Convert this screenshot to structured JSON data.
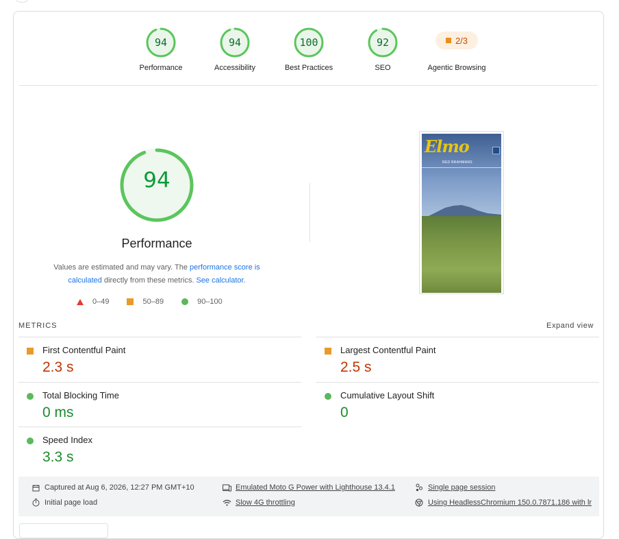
{
  "colors": {
    "pass": "#0c9a3a",
    "average": "#ea9a2a",
    "fail": "#e53935",
    "link": "#1a73e8"
  },
  "gauges": [
    {
      "score": "94",
      "label": "Performance",
      "fraction": 0.94
    },
    {
      "score": "94",
      "label": "Accessibility",
      "fraction": 0.94
    },
    {
      "score": "100",
      "label": "Best Practices",
      "fraction": 1.0
    },
    {
      "score": "92",
      "label": "SEO",
      "fraction": 0.92
    }
  ],
  "agentic": {
    "badge": "2/3",
    "label": "Agentic Browsing"
  },
  "main": {
    "score": "94",
    "fraction": 0.94,
    "title": "Performance",
    "desc_1": "Values are estimated and may vary. The ",
    "desc_link_1": "performance score is calculated",
    "desc_2": " directly from these metrics. ",
    "desc_link_2": "See calculator",
    "desc_3": ".",
    "legend": {
      "fail": "0–49",
      "average": "50–89",
      "pass": "90–100"
    }
  },
  "thumbnail": {
    "logo": "Elmo",
    "tagline": "RED BRAHMANS"
  },
  "metrics": {
    "heading": "METRICS",
    "expand": "Expand view",
    "fcp": {
      "name": "First Contentful Paint",
      "value": "2.3 s"
    },
    "lcp": {
      "name": "Largest Contentful Paint",
      "value": "2.5 s"
    },
    "tbt": {
      "name": "Total Blocking Time",
      "value": "0 ms"
    },
    "cls": {
      "name": "Cumulative Layout Shift",
      "value": "0"
    },
    "si": {
      "name": "Speed Index",
      "value": "3.3 s"
    }
  },
  "footer": {
    "captured": "Captured at Aug 6, 2026, 12:27 PM GMT+10",
    "initial": "Initial page load",
    "emulated": "Emulated Moto G Power with Lighthouse 13.4.1",
    "throttling": "Slow 4G throttling",
    "session": "Single page session",
    "browser": "Using HeadlessChromium 150.0.7871.186 with lr"
  }
}
